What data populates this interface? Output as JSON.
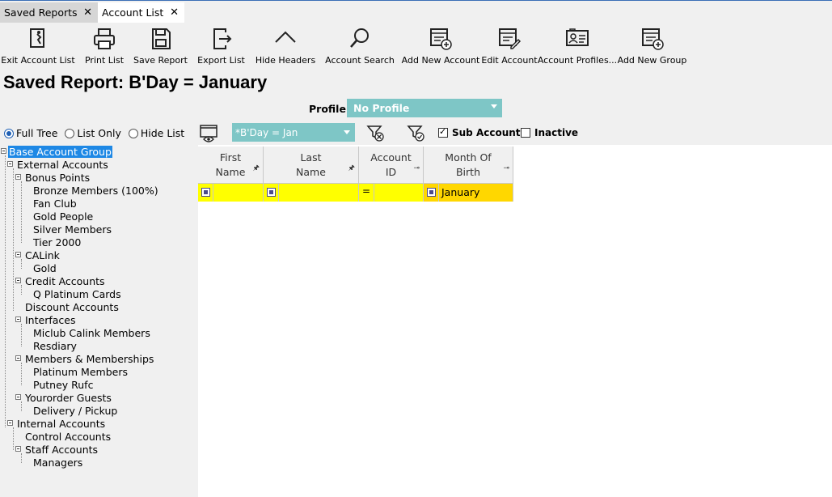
{
  "tabs": [
    {
      "label": "Saved Reports",
      "active": false
    },
    {
      "label": "Account List",
      "active": true
    }
  ],
  "toolbar": {
    "exit": "Exit Account List",
    "print": "Print List",
    "save": "Save Report",
    "export": "Export List",
    "hide_headers": "Hide Headers",
    "search": "Account Search",
    "add_account": "Add New Account",
    "edit_account": "Edit Account",
    "profiles": "Account Profiles...",
    "add_group": "Add New Group"
  },
  "page_title": "Saved Report: B'Day = January",
  "profile": {
    "label": "Profile:",
    "value": "No Profile"
  },
  "view_options": {
    "full_tree": "Full Tree",
    "list_only": "List Only",
    "hide_list": "Hide List",
    "selected": "full_tree"
  },
  "filter": {
    "value": "*B'Day = Jan",
    "sub_accounts": "Sub Accounts",
    "sub_accounts_checked": true,
    "inactive": "Inactive",
    "inactive_checked": false
  },
  "tree": {
    "root": "Base Account Group",
    "external": "External Accounts",
    "bonus_points": "Bonus Points",
    "bronze": "Bronze Members (100%)",
    "fan_club": "Fan Club",
    "gold_people": "Gold People",
    "silver": "Silver Members",
    "tier2000": "Tier 2000",
    "calink": "CALink",
    "gold": "Gold",
    "credit": "Credit Accounts",
    "q_platinum": "Q Platinum Cards",
    "discount": "Discount Accounts",
    "interfaces": "Interfaces",
    "miclub": "Miclub Calink Members",
    "resdiary": "Resdiary",
    "members": "Members & Memberships",
    "platinum": "Platinum Members",
    "putney": "Putney Rufc",
    "yourorder": "Yourorder Guests",
    "delivery": "Delivery / Pickup",
    "internal": "Internal Accounts",
    "control": "Control Accounts",
    "staff": "Staff Accounts",
    "managers": "Managers"
  },
  "grid": {
    "columns": [
      {
        "line1": "First",
        "line2": "Name"
      },
      {
        "line1": "Last",
        "line2": "Name"
      },
      {
        "line1": "Account",
        "line2": "ID"
      },
      {
        "line1": "Month Of",
        "line2": "Birth"
      }
    ],
    "filter_values": {
      "month": "January"
    }
  },
  "colors": {
    "accent": "#7ec6c6",
    "tree_selected": "#1e88e5",
    "filter_row": "#ffff00",
    "filter_active": "#ffd700"
  }
}
